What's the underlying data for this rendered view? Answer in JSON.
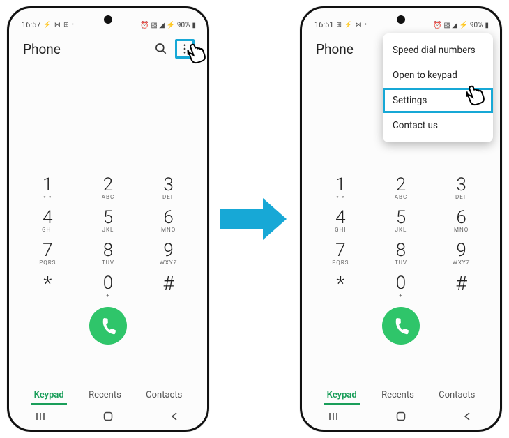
{
  "status_left": {
    "time": "16:57",
    "time2": "16:51",
    "icons": "⚡ ⋈ ⊞ •"
  },
  "status_right": {
    "icons": "⏰ ▧ ◢ 📶 ⚡",
    "battery": "90%"
  },
  "app_title": "Phone",
  "menu": {
    "items": [
      "Speed dial numbers",
      "Open to keypad",
      "Settings",
      "Contact us"
    ],
    "highlight_index": 2
  },
  "keypad": [
    [
      {
        "d": "1",
        "l": "⚬⚬"
      },
      {
        "d": "2",
        "l": "ABC"
      },
      {
        "d": "3",
        "l": "DEF"
      }
    ],
    [
      {
        "d": "4",
        "l": "GHI"
      },
      {
        "d": "5",
        "l": "JKL"
      },
      {
        "d": "6",
        "l": "MNO"
      }
    ],
    [
      {
        "d": "7",
        "l": "PQRS"
      },
      {
        "d": "8",
        "l": "TUV"
      },
      {
        "d": "9",
        "l": "WXYZ"
      }
    ],
    [
      {
        "d": "*",
        "l": ""
      },
      {
        "d": "0",
        "l": "+"
      },
      {
        "d": "#",
        "l": ""
      }
    ]
  ],
  "tabs": {
    "keypad": "Keypad",
    "recents": "Recents",
    "contacts": "Contacts"
  },
  "colors": {
    "accent": "#17a8d6",
    "call": "#2fc56a",
    "active": "#1a9e5a"
  }
}
